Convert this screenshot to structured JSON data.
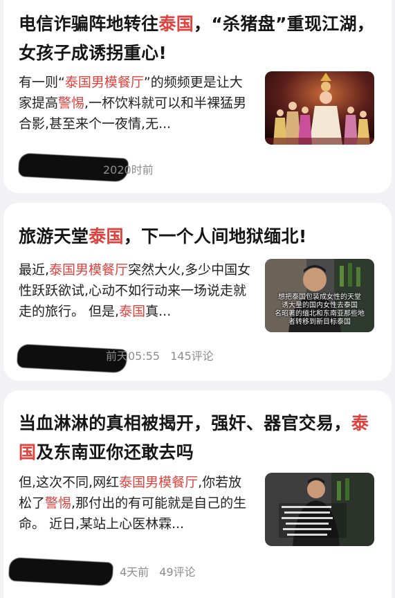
{
  "articles": [
    {
      "title_parts": [
        {
          "t": "电信诈骗阵地转往",
          "hl": false
        },
        {
          "t": "泰国",
          "hl": true
        },
        {
          "t": "，“杀猪盘”重现江湖，女孩子成诱拐重心!",
          "hl": false
        }
      ],
      "snippet_parts": [
        {
          "t": "有一则“",
          "hl": false
        },
        {
          "t": "泰国男模餐厅",
          "hl": true
        },
        {
          "t": "”的频频更是让大家提高",
          "hl": false
        },
        {
          "t": "警惕",
          "hl": true
        },
        {
          "t": ",一杯饮料就可以和半裸猛男合影,甚至来个一夜情,无...",
          "hl": false
        }
      ],
      "time": "2020时前",
      "comments": "",
      "thumb": "stage-dancers"
    },
    {
      "title_parts": [
        {
          "t": "旅游天堂",
          "hl": false
        },
        {
          "t": "泰国",
          "hl": true
        },
        {
          "t": "，下一个人间地狱缅北!",
          "hl": false
        }
      ],
      "snippet_parts": [
        {
          "t": "最近,",
          "hl": false
        },
        {
          "t": "泰国男模餐厅",
          "hl": true
        },
        {
          "t": "突然大火,多少中国女性跃跃欲试,心动不如行动来一场说走就走的旅行。 但是,",
          "hl": false
        },
        {
          "t": "泰国",
          "hl": true
        },
        {
          "t": "真...",
          "hl": false
        }
      ],
      "time": "前天05:55",
      "comments": "145评论",
      "thumb": "video-man",
      "thumb_captions": [
        "想把泰国包装成女性的天堂",
        "诱大量的国内女性去泰国",
        "名昭著的缅北和东南亚那些地",
        "者转移到新目标泰国"
      ]
    },
    {
      "title_parts": [
        {
          "t": "当血淋淋的真相被揭开，强奸、器官交易，",
          "hl": false
        },
        {
          "t": "泰国",
          "hl": true
        },
        {
          "t": "及东南亚你还敢去吗",
          "hl": false
        }
      ],
      "snippet_parts": [
        {
          "t": "但,这次不同,网红",
          "hl": false
        },
        {
          "t": "泰国男模餐厅",
          "hl": true
        },
        {
          "t": ",你若放松了",
          "hl": false
        },
        {
          "t": "警惕",
          "hl": true
        },
        {
          "t": ",那付出的有可能就是自己的生命。 近日,某站上心医林霖...",
          "hl": false
        }
      ],
      "time": "4天前",
      "comments": "49评论",
      "thumb": "video-man-2"
    }
  ],
  "colors": {
    "highlight": "#e0423e",
    "meta": "#8c8c8c",
    "background": "#f2f2f4"
  }
}
